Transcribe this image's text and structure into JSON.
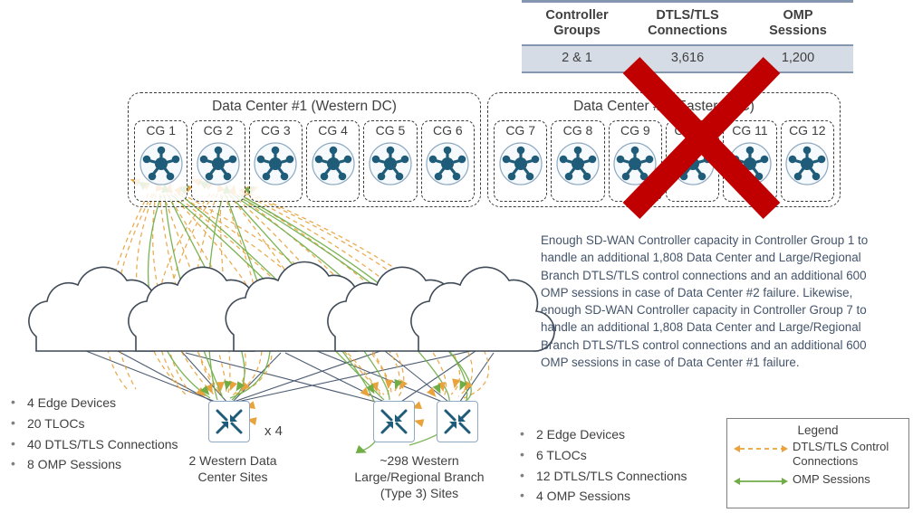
{
  "summary": {
    "headers": [
      "Controller\nGroups",
      "DTLS/TLS\nConnections",
      "OMP\nSessions"
    ],
    "header_controller_line1": "Controller",
    "header_controller_line2": "Groups",
    "header_dtls_line1": "DTLS/TLS",
    "header_dtls_line2": "Connections",
    "header_omp_line1": "OMP",
    "header_omp_line2": "Sessions",
    "value_controller_groups": "2 & 1",
    "value_dtls_connections": "3,616",
    "value_omp_sessions": "1,200"
  },
  "data_centers": [
    {
      "title": "Data Center #1 (Western DC)",
      "groups": [
        "CG 1",
        "CG 2",
        "CG 3",
        "CG 4",
        "CG 5",
        "CG 6"
      ],
      "failed": false
    },
    {
      "title": "Data Center #2 (Eastern DC)",
      "groups": [
        "CG 7",
        "CG 8",
        "CG 9",
        "CG 10",
        "CG 11",
        "CG 12"
      ],
      "failed": true
    }
  ],
  "failure_marker": {
    "name": "red-x-over-data-center-2",
    "color": "#C00000"
  },
  "description": "Enough SD-WAN Controller capacity in Controller Group 1 to handle an additional 1,808 Data Center and Large/Regional Branch DTLS/TLS control connections and an additional 600 OMP sessions in case of Data Center #2 failure. Likewise, enough SD-WAN Controller capacity in Controller Group 7 to handle an additional 1,808 Data Center and Large/Regional Branch DTLS/TLS control connections and an additional 600 OMP sessions in case of Data Center #1 failure.",
  "bullets_left": [
    "4 Edge Devices",
    "20 TLOCs",
    "40 DTLS/TLS  Connections",
    "8 OMP Sessions"
  ],
  "bullets_right": [
    "2 Edge Devices",
    "6 TLOCs",
    "12 DTLS/TLS  Connections",
    "4 OMP Sessions"
  ],
  "sites": {
    "dc_sites_caption_line1": "2 Western Data",
    "dc_sites_caption_line2": "Center Sites",
    "dc_sites_multiplier": "x 4",
    "branch_caption_line1": "~298 Western",
    "branch_caption_line2": "Large/Regional Branch",
    "branch_caption_line3": "(Type 3) Sites"
  },
  "legend": {
    "title": "Legend",
    "items": [
      {
        "label": "DTLS/TLS  Control Connections",
        "style": "dashed",
        "color": "#E8A33D"
      },
      {
        "label": "OMP Sessions",
        "style": "solid",
        "color": "#70AD47"
      }
    ]
  },
  "colors": {
    "dtls_orange": "#E8A33D",
    "omp_green": "#70AD47",
    "transport_line": "#44546A",
    "node_blue": "#1F5C7A",
    "table_row_bg": "#D6DCE5",
    "table_rule": "#8496B0",
    "text_body": "#44546A",
    "failure_red": "#C00000"
  },
  "transports": {
    "count": 5,
    "name": "wan-transport-cloud"
  }
}
